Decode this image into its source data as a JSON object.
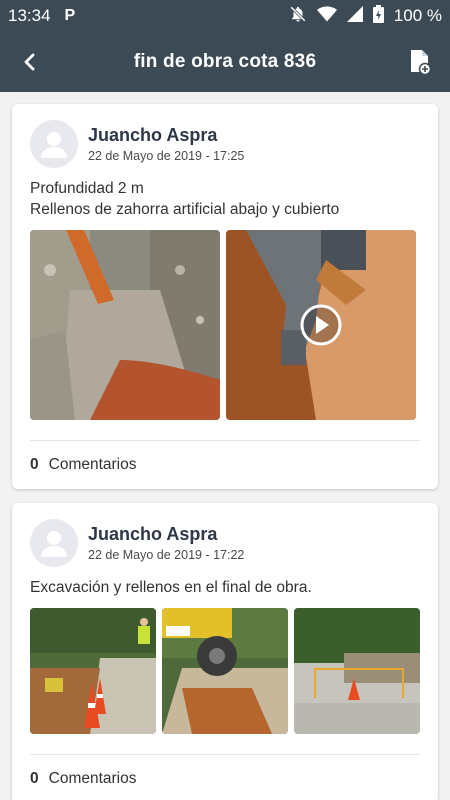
{
  "status_bar": {
    "time": "13:34",
    "notification_icon": "P",
    "battery": "100 %",
    "icons": [
      "notifications-off-icon",
      "wifi-icon",
      "signal-icon",
      "battery-charging-icon"
    ]
  },
  "app_bar": {
    "title": "fin de obra cota 836",
    "back_icon": "back-arrow-icon",
    "action_icon": "add-document-icon"
  },
  "posts": [
    {
      "author": "Juancho Aspra",
      "date": "22 de Mayo de 2019 - 17:25",
      "text_lines": [
        "Profundidad 2 m",
        "Rellenos de zahorra artificial abajo y cubierto"
      ],
      "media": [
        {
          "kind": "photo",
          "subject": "trench-with-pipe"
        },
        {
          "kind": "video",
          "subject": "compactor-in-trench"
        }
      ],
      "comments_count": "0",
      "comments_label": "Comentarios"
    },
    {
      "author": "Juancho Aspra",
      "date": "22 de Mayo de 2019 - 17:22",
      "text_lines": [
        "Excavación y rellenos en el final de obra."
      ],
      "media": [
        {
          "kind": "photo",
          "subject": "worker-and-cones"
        },
        {
          "kind": "photo",
          "subject": "dumper-in-trench"
        },
        {
          "kind": "photo",
          "subject": "fenced-worksite"
        }
      ],
      "comments_count": "0",
      "comments_label": "Comentarios"
    }
  ],
  "colors": {
    "header_bg": "#3b4a54",
    "page_bg": "#f2f2f2",
    "card_bg": "#ffffff",
    "author_name": "#2d3748"
  }
}
